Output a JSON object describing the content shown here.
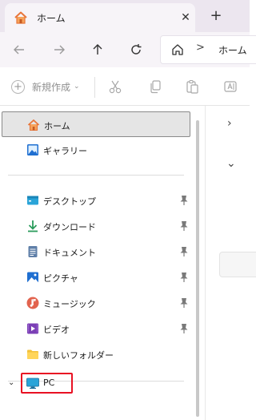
{
  "tab": {
    "title": "ホーム",
    "close": "✕",
    "new_tab": "+"
  },
  "address": {
    "separator": ">",
    "location": "ホーム"
  },
  "toolbar": {
    "new_label": "新規作成",
    "new_dropdown": "⌄"
  },
  "sidebar": {
    "home": "ホーム",
    "gallery": "ギャラリー",
    "quick_access": [
      {
        "label": "デスクトップ",
        "icon": "desktop-folder-icon"
      },
      {
        "label": "ダウンロード",
        "icon": "download-icon"
      },
      {
        "label": "ドキュメント",
        "icon": "document-icon"
      },
      {
        "label": "ピクチャ",
        "icon": "pictures-icon"
      },
      {
        "label": "ミュージック",
        "icon": "music-icon"
      },
      {
        "label": "ビデオ",
        "icon": "video-icon"
      },
      {
        "label": "新しいフォルダー",
        "icon": "folder-icon"
      }
    ],
    "pc": "PC",
    "pc_expand": "⌄"
  },
  "right": {
    "chevron_right": "›",
    "chevron_down": "⌄"
  },
  "colors": {
    "tabstrip": "#ece6ef",
    "selected_item": "#e5e5e5",
    "highlight_border": "#e81123",
    "home_icon_orange": "#e8763a",
    "download_green": "#2a9b5b"
  }
}
